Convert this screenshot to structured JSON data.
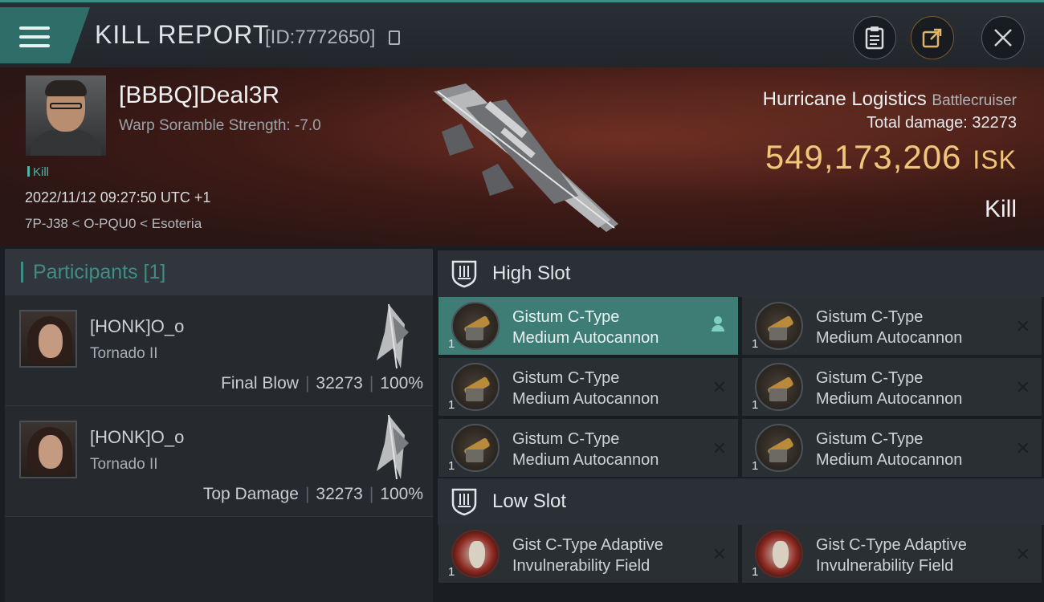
{
  "header": {
    "title": "KILL REPORT",
    "report_id": "[ID:7772650]",
    "buttons": [
      "clipboard-icon",
      "share-icon",
      "close-icon"
    ]
  },
  "victim": {
    "name": "[BBBQ]Deal3R",
    "scramble": "Warp Soramble Strength: -7.0",
    "kill_tag": "Kill",
    "datetime": "2022/11/12 09:27:50 UTC +1",
    "location": "7P-J38 < O-PQU0 < Esoteria"
  },
  "ship": {
    "name": "Hurricane Logistics",
    "class": "Battlecruiser",
    "total_damage_label": "Total damage:",
    "total_damage": "32273",
    "isk_value": "549,173,206",
    "isk_unit": "ISK",
    "result": "Kill"
  },
  "participants": {
    "header": "Participants [1]",
    "rows": [
      {
        "name": "[HONK]O_o",
        "ship": "Tornado II",
        "role": "Final Blow",
        "damage": "32273",
        "percent": "100%"
      },
      {
        "name": "[HONK]O_o",
        "ship": "Tornado II",
        "role": "Top Damage",
        "damage": "32273",
        "percent": "100%"
      }
    ]
  },
  "high_slot": {
    "label": "High Slot",
    "items": [
      {
        "line1": "Gistum C-Type",
        "line2": "Medium Autocannon",
        "qty": "1"
      },
      {
        "line1": "Gistum C-Type",
        "line2": "Medium Autocannon",
        "qty": "1"
      },
      {
        "line1": "Gistum C-Type",
        "line2": "Medium Autocannon",
        "qty": "1"
      },
      {
        "line1": "Gistum C-Type",
        "line2": "Medium Autocannon",
        "qty": "1"
      },
      {
        "line1": "Gistum C-Type",
        "line2": "Medium Autocannon",
        "qty": "1"
      },
      {
        "line1": "Gistum C-Type",
        "line2": "Medium Autocannon",
        "qty": "1"
      }
    ]
  },
  "low_slot": {
    "label": "Low Slot",
    "items": [
      {
        "line1": "Gist C-Type Adaptive",
        "line2": "Invulnerability Field",
        "qty": "1"
      },
      {
        "line1": "Gist C-Type Adaptive",
        "line2": "Invulnerability Field",
        "qty": "1"
      }
    ]
  },
  "colors": {
    "accent": "#3e7c76",
    "isk": "#f0c67a",
    "hero": "#6a2c22"
  }
}
